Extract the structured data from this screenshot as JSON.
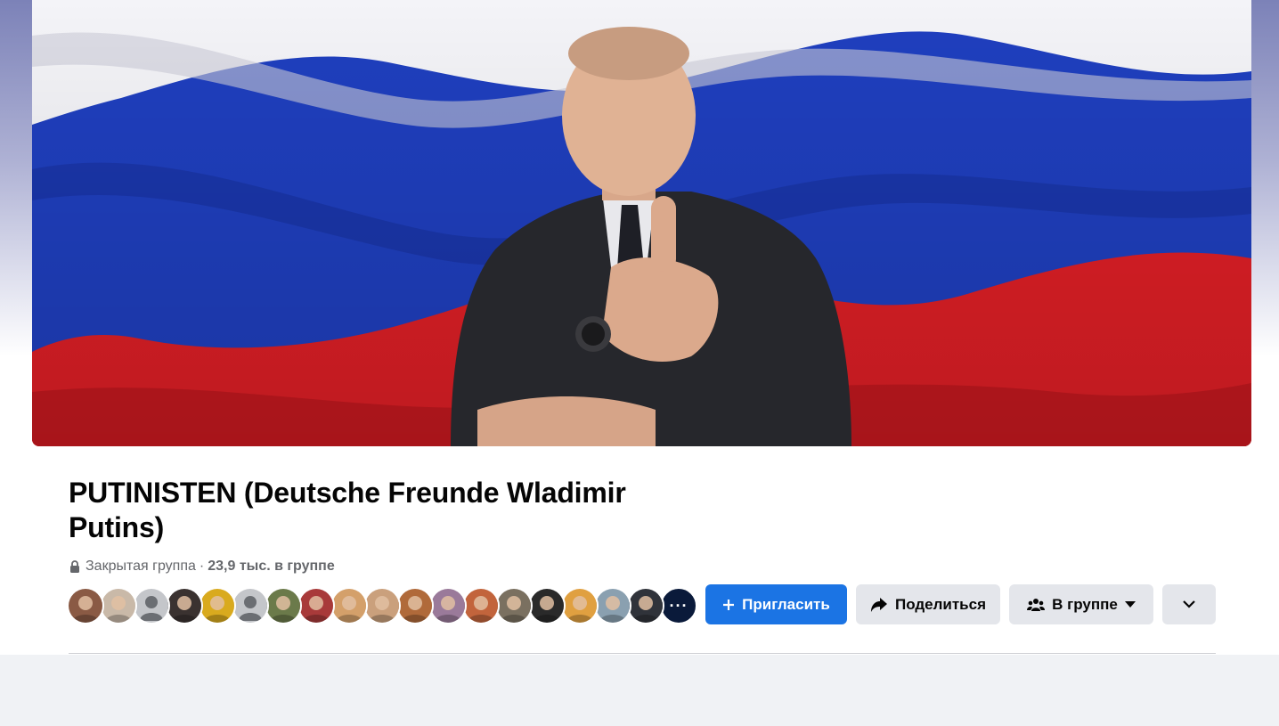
{
  "group": {
    "title": "PUTINISTEN (Deutsche Freunde Wladimir Putins)",
    "privacy": "Закрытая группа",
    "separator": "·",
    "members": "23,9 тыс. в группе"
  },
  "avatars": {
    "more_label": "···",
    "items": [
      {
        "name": "member-avatar-1",
        "bg": "#8a5a44"
      },
      {
        "name": "member-avatar-2",
        "bg": "#c9b9a8"
      },
      {
        "name": "member-avatar-3",
        "bg": "#c4c6ca",
        "placeholder": true
      },
      {
        "name": "member-avatar-4",
        "bg": "#3a3230"
      },
      {
        "name": "member-avatar-5",
        "bg": "#d9aa1e"
      },
      {
        "name": "member-avatar-6",
        "bg": "#c4c6ca",
        "placeholder": true
      },
      {
        "name": "member-avatar-7",
        "bg": "#6b7a4a"
      },
      {
        "name": "member-avatar-8",
        "bg": "#a83a3a"
      },
      {
        "name": "member-avatar-9",
        "bg": "#d4a06a"
      },
      {
        "name": "member-avatar-10",
        "bg": "#caa07c"
      },
      {
        "name": "member-avatar-11",
        "bg": "#b06a3a"
      },
      {
        "name": "member-avatar-12",
        "bg": "#9a7a9a"
      },
      {
        "name": "member-avatar-13",
        "bg": "#c2643c"
      },
      {
        "name": "member-avatar-14",
        "bg": "#7a7060"
      },
      {
        "name": "member-avatar-15",
        "bg": "#2a2a2a"
      },
      {
        "name": "member-avatar-16",
        "bg": "#e0a040"
      },
      {
        "name": "member-avatar-17",
        "bg": "#8aa0b0"
      },
      {
        "name": "member-avatar-18",
        "bg": "#30333a"
      }
    ]
  },
  "actions": {
    "invite_label": "Пригласить",
    "share_label": "Поделиться",
    "joined_label": "В группе"
  },
  "icons": {
    "lock": "lock-icon",
    "plus": "plus-icon",
    "share": "share-arrow-icon",
    "members": "group-members-icon",
    "caret": "caret-down-icon",
    "chevron": "chevron-down-icon"
  },
  "colors": {
    "primary": "#1b74e4",
    "secondary_button": "#e4e6eb",
    "text_primary": "#050505",
    "text_secondary": "#65676b",
    "page_bg": "#f0f2f5",
    "flag_white": "#f4f4f8",
    "flag_blue": "#1f3fbf",
    "flag_red": "#e01f26"
  }
}
